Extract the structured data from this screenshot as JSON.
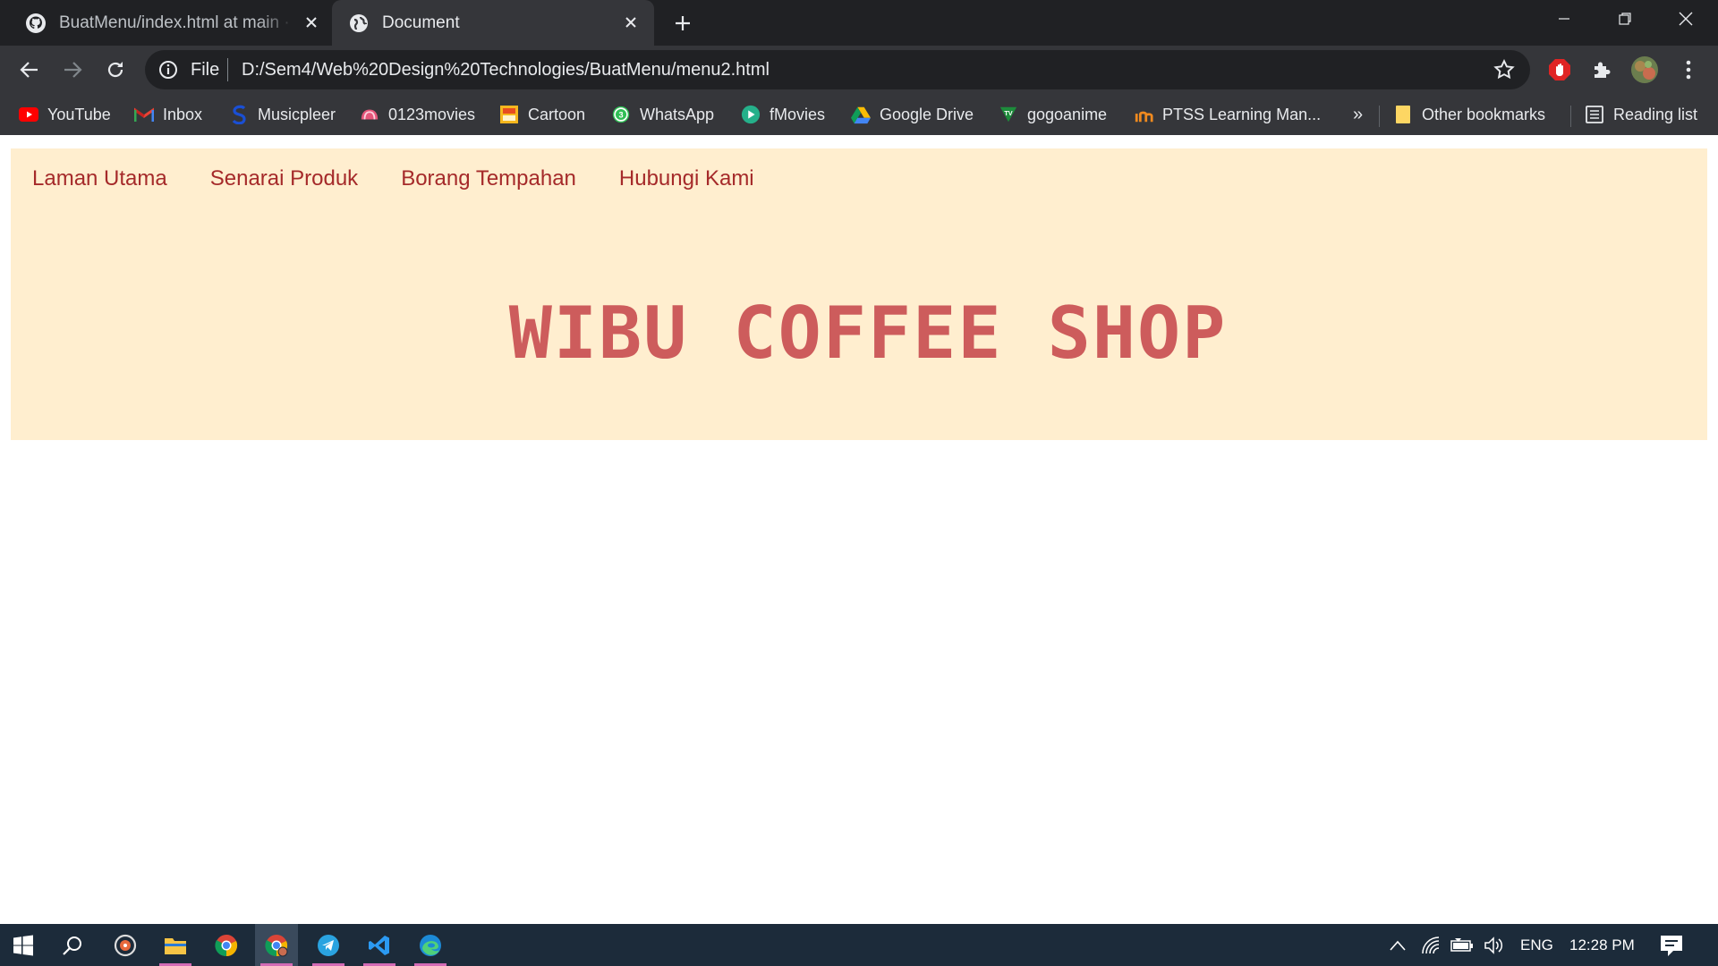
{
  "browser": {
    "tabs": [
      {
        "title": "BuatMenu/index.html at main · Fi",
        "favicon": "github-icon"
      },
      {
        "title": "Document",
        "favicon": "globe-icon"
      }
    ],
    "address_bar": {
      "scheme_label": "File",
      "url": "D:/Sem4/Web%20Design%20Technologies/BuatMenu/menu2.html"
    },
    "bookmarks": [
      {
        "label": "YouTube",
        "icon": "youtube-icon"
      },
      {
        "label": "Inbox",
        "icon": "gmail-icon"
      },
      {
        "label": "Musicpleer",
        "icon": "musicpleer-icon"
      },
      {
        "label": "0123movies",
        "icon": "0123movies-icon"
      },
      {
        "label": "Cartoon",
        "icon": "cartoon-icon"
      },
      {
        "label": "WhatsApp",
        "icon": "whatsapp-icon"
      },
      {
        "label": "fMovies",
        "icon": "fmovies-icon"
      },
      {
        "label": "Google Drive",
        "icon": "google-drive-icon"
      },
      {
        "label": "gogoanime",
        "icon": "gogoanime-icon"
      },
      {
        "label": "PTSS Learning Man...",
        "icon": "ptss-icon"
      }
    ],
    "overflow_label": "»",
    "other_bookmarks_label": "Other bookmarks",
    "reading_list_label": "Reading list"
  },
  "page": {
    "nav": [
      "Laman Utama",
      "Senarai Produk",
      "Borang Tempahan",
      "Hubungi Kami"
    ],
    "title": "WIBU COFFEE SHOP",
    "colors": {
      "header_bg": "#ffeecf",
      "nav_link": "#a52a2a",
      "title": "#cd5c5c"
    }
  },
  "taskbar": {
    "language": "ENG",
    "time": "12:28 PM"
  }
}
